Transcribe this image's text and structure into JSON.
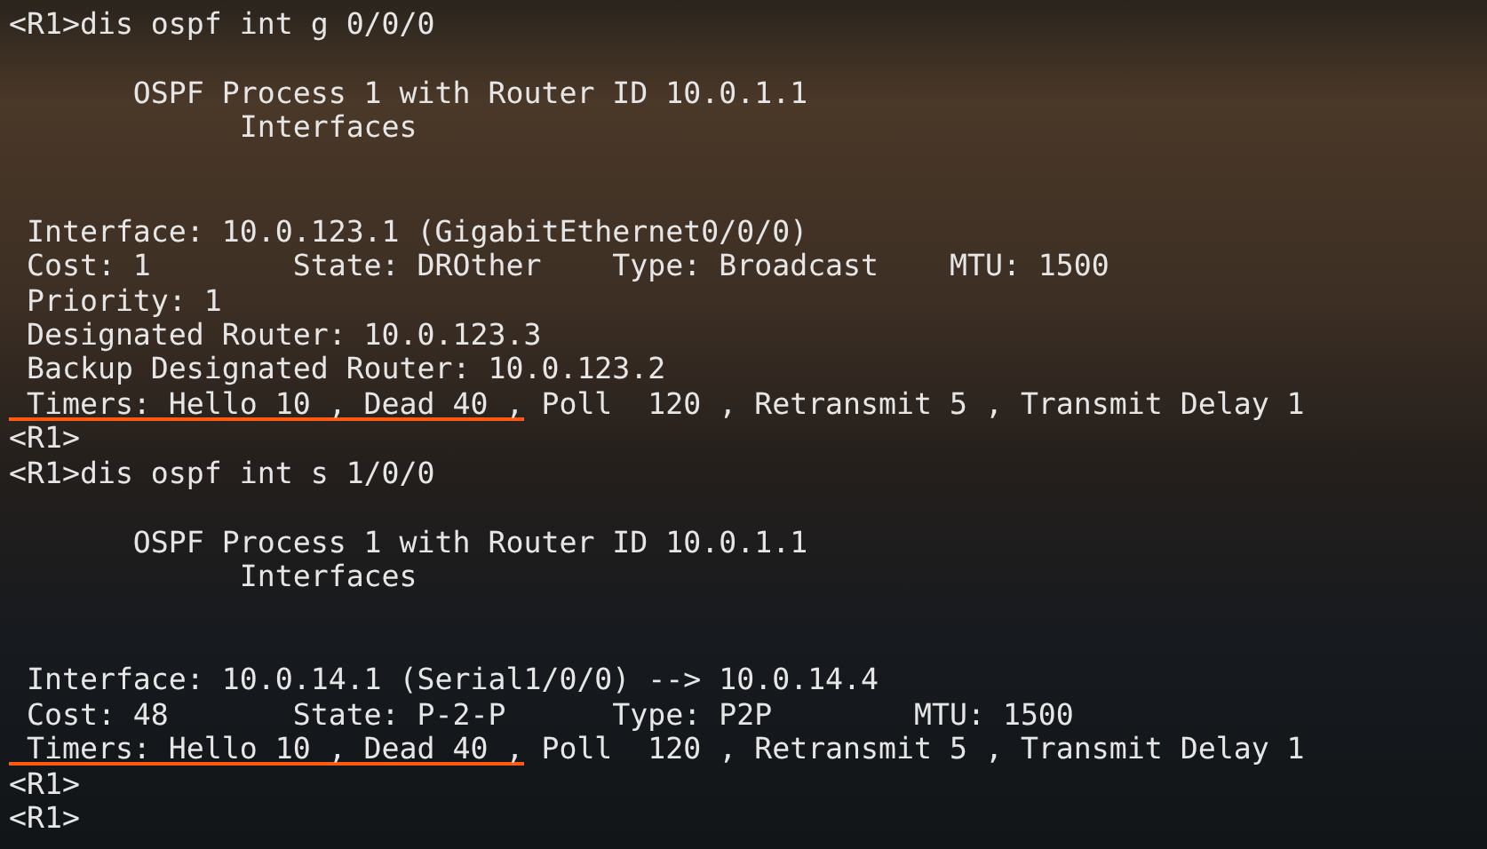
{
  "terminal": {
    "lines": [
      {
        "kind": "text",
        "segments": [
          {
            "text": "<R1>dis ospf int g 0/0/0",
            "underlined": false
          }
        ]
      },
      {
        "kind": "blank"
      },
      {
        "kind": "text",
        "segments": [
          {
            "text": "       OSPF Process 1 with Router ID 10.0.1.1",
            "underlined": false
          }
        ]
      },
      {
        "kind": "text",
        "segments": [
          {
            "text": "             Interfaces",
            "underlined": false
          }
        ]
      },
      {
        "kind": "blank"
      },
      {
        "kind": "blank"
      },
      {
        "kind": "text",
        "segments": [
          {
            "text": " Interface: 10.0.123.1 (GigabitEthernet0/0/0)",
            "underlined": false
          }
        ]
      },
      {
        "kind": "text",
        "segments": [
          {
            "text": " Cost: 1        State: DROther    Type: Broadcast    MTU: 1500",
            "underlined": false
          }
        ]
      },
      {
        "kind": "text",
        "segments": [
          {
            "text": " Priority: 1",
            "underlined": false
          }
        ]
      },
      {
        "kind": "text",
        "segments": [
          {
            "text": " Designated Router: 10.0.123.3",
            "underlined": false
          }
        ]
      },
      {
        "kind": "text",
        "segments": [
          {
            "text": " Backup Designated Router: 10.0.123.2",
            "underlined": false
          }
        ]
      },
      {
        "kind": "text",
        "segments": [
          {
            "text": " Timers: Hello 10 , Dead 40 ,",
            "underlined": true
          },
          {
            "text": " Poll  120 , Retransmit 5 , Transmit Delay 1",
            "underlined": false
          }
        ]
      },
      {
        "kind": "text",
        "segments": [
          {
            "text": "<R1>",
            "underlined": false
          }
        ]
      },
      {
        "kind": "text",
        "segments": [
          {
            "text": "<R1>dis ospf int s 1/0/0",
            "underlined": false
          }
        ]
      },
      {
        "kind": "blank"
      },
      {
        "kind": "text",
        "segments": [
          {
            "text": "       OSPF Process 1 with Router ID 10.0.1.1",
            "underlined": false
          }
        ]
      },
      {
        "kind": "text",
        "segments": [
          {
            "text": "             Interfaces",
            "underlined": false
          }
        ]
      },
      {
        "kind": "blank"
      },
      {
        "kind": "blank"
      },
      {
        "kind": "text",
        "segments": [
          {
            "text": " Interface: 10.0.14.1 (Serial1/0/0) --> 10.0.14.4",
            "underlined": false
          }
        ]
      },
      {
        "kind": "text",
        "segments": [
          {
            "text": " Cost: 48       State: P-2-P      Type: P2P        MTU: 1500",
            "underlined": false
          }
        ]
      },
      {
        "kind": "text",
        "segments": [
          {
            "text": " Timers: Hello 10 , Dead 40 ,",
            "underlined": true
          },
          {
            "text": " Poll  120 , Retransmit 5 , Transmit Delay 1",
            "underlined": false
          }
        ]
      },
      {
        "kind": "text",
        "segments": [
          {
            "text": "<R1>",
            "underlined": false
          }
        ]
      },
      {
        "kind": "text",
        "segments": [
          {
            "text": "<R1>",
            "underlined": false
          }
        ]
      }
    ]
  }
}
